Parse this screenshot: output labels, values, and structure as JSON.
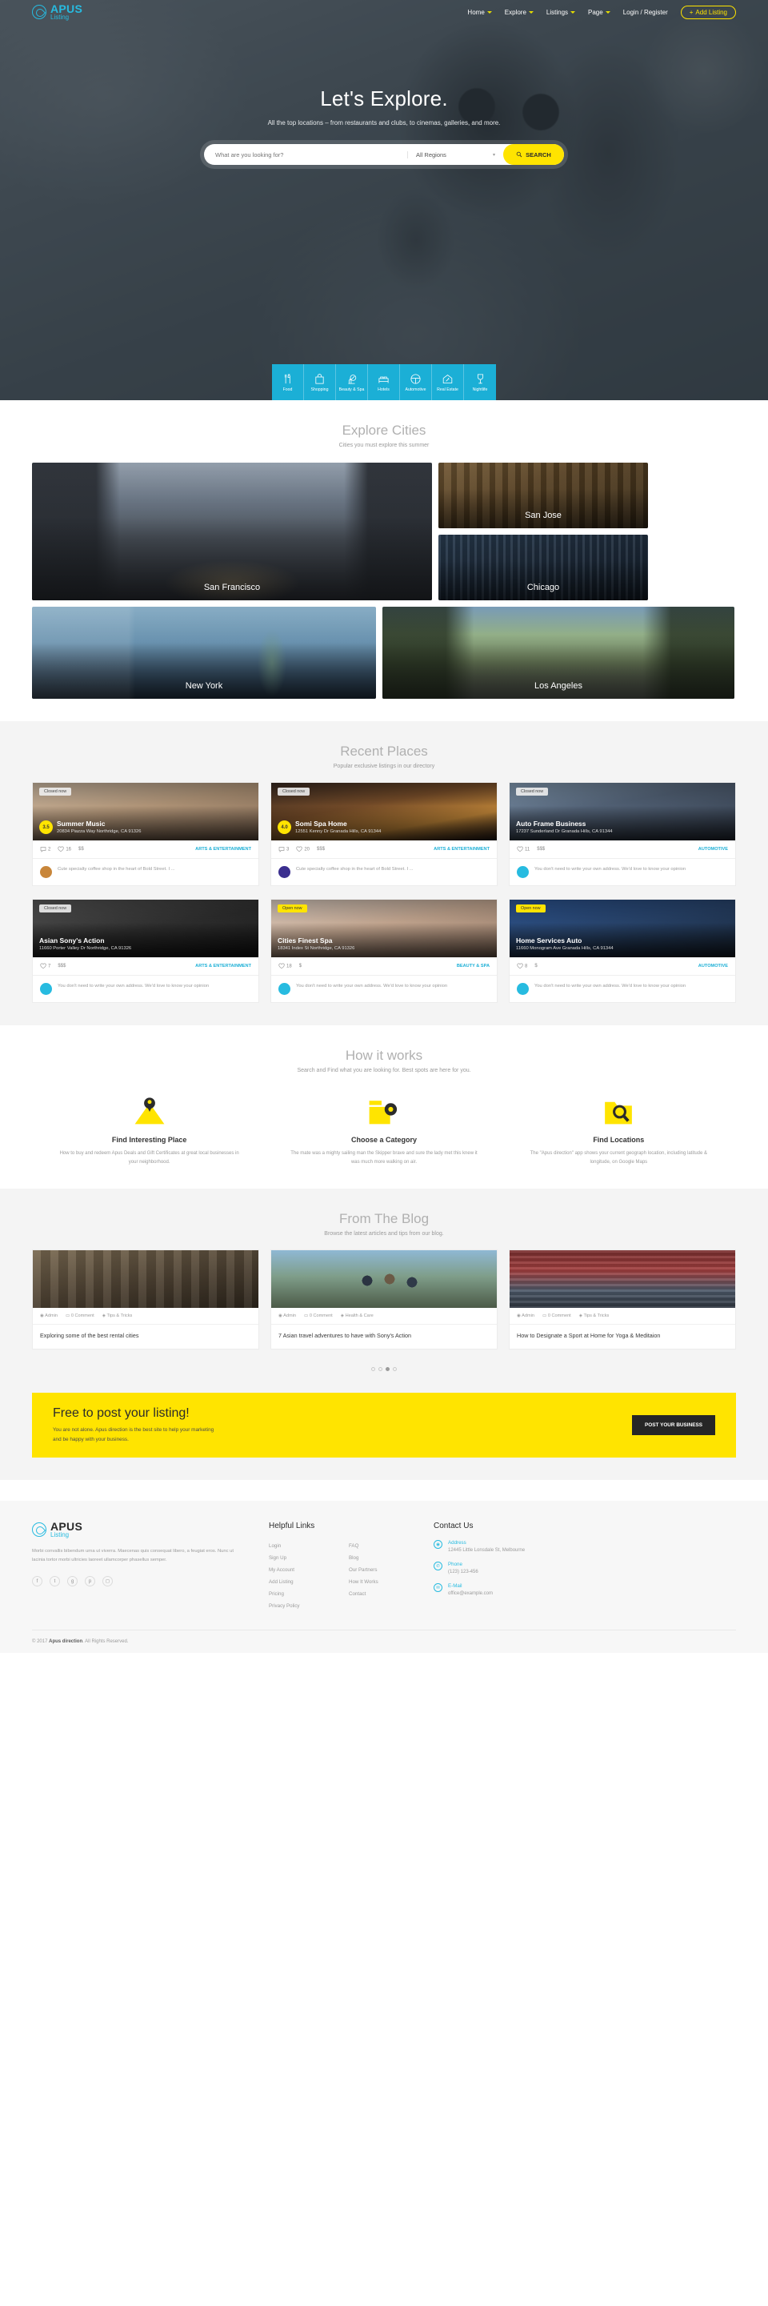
{
  "header": {
    "logo": {
      "line1": "APUS",
      "line2": "Listing",
      "icon": "compass-icon"
    },
    "nav": [
      {
        "label": "Home",
        "caret": true
      },
      {
        "label": "Explore",
        "caret": true
      },
      {
        "label": "Listings",
        "caret": true
      },
      {
        "label": "Page",
        "caret": true
      },
      {
        "label": "Login / Register",
        "caret": false
      }
    ],
    "add_listing": "Add Listing",
    "add_listing_plus": "+"
  },
  "hero": {
    "title": "Let's Explore.",
    "subtitle": "All the top locations – from restaurants and clubs, to cinemas, galleries, and more.",
    "search_placeholder": "What are you looking for?",
    "region_value": "All Regions",
    "search_button": "SEARCH",
    "categories": [
      {
        "label": "Food",
        "icon": "fork-knife-icon"
      },
      {
        "label": "Shopping",
        "icon": "shopping-bag-icon"
      },
      {
        "label": "Beauty & Spa",
        "icon": "lipstick-mirror-icon"
      },
      {
        "label": "Hotels",
        "icon": "bed-icon"
      },
      {
        "label": "Automotive",
        "icon": "steering-wheel-icon"
      },
      {
        "label": "Real Estate",
        "icon": "house-key-icon"
      },
      {
        "label": "Nightlife",
        "icon": "wine-glass-icon"
      }
    ]
  },
  "cities": {
    "title": "Explore Cities",
    "subtitle": "Cities you must explore this summer",
    "items": [
      {
        "name": "San Francisco"
      },
      {
        "name": "San Jose"
      },
      {
        "name": "Chicago"
      },
      {
        "name": "New York"
      },
      {
        "name": "Los Angeles"
      }
    ]
  },
  "recent": {
    "title": "Recent Places",
    "subtitle": "Popular exclusive listings in our directory",
    "comment_text": "Cute specialty coffee shop in the heart of Bold Street. I ...",
    "comment_text_alt": "You don't need to write your own address. We'd love to know your opinion",
    "cards": [
      {
        "status": "Closed now",
        "status_type": "closed",
        "rating": "3.5",
        "title": "Summer Music",
        "address": "20834 Piazza Way Northridge, CA 91326",
        "comments": "2",
        "likes": "16",
        "price": "$$",
        "category": "ARTS & ENTERTAINMENT",
        "avatar": "k",
        "comment": "Cute specialty coffee shop in the heart of Bold Street. I ..."
      },
      {
        "status": "Closed now",
        "status_type": "closed",
        "rating": "4.0",
        "title": "Somi Spa Home",
        "address": "12551 Kenny Dr Granada Hills, CA 91344",
        "comments": "3",
        "likes": "20",
        "price": "$$$",
        "category": "ARTS & ENTERTAINMENT",
        "avatar": "p",
        "comment": "Cute specialty coffee shop in the heart of Bold Street. I ..."
      },
      {
        "status": "Closed now",
        "status_type": "closed",
        "rating": "",
        "title": "Auto Frame Business",
        "address": "17237 Sunderland Dr Granada Hills, CA 91344",
        "comments": "",
        "likes": "11",
        "price": "$$$",
        "category": "AUTOMOTIVE",
        "avatar": "t",
        "comment": "You don't need to write your own address. We'd love to know your opinion"
      },
      {
        "status": "Closed now",
        "status_type": "closed",
        "rating": "",
        "title": "Asian Sony's Action",
        "address": "11660 Porter Valley Dr Northridge, CA 91326",
        "comments": "",
        "likes": "7",
        "price": "$$$",
        "category": "ARTS & ENTERTAINMENT",
        "avatar": "t",
        "comment": "You don't need to write your own address. We'd love to know your opinion"
      },
      {
        "status": "Open now",
        "status_type": "open",
        "rating": "",
        "title": "Cities Finest Spa",
        "address": "18341 Index St Northridge, CA 91326",
        "comments": "",
        "likes": "18",
        "price": "$",
        "category": "BEAUTY & SPA",
        "avatar": "t",
        "comment": "You don't need to write your own address. We'd love to know your opinion"
      },
      {
        "status": "Open now",
        "status_type": "open",
        "rating": "",
        "title": "Home Services Auto",
        "address": "11660 Monogram Ave Granada Hills, CA 91344",
        "comments": "",
        "likes": "8",
        "price": "$",
        "category": "AUTOMOTIVE",
        "avatar": "t",
        "comment": "You don't need to write your own address. We'd love to know your opinion"
      }
    ]
  },
  "how": {
    "title": "How it works",
    "subtitle": "Search and Find what you are looking for. Best spots are here for you.",
    "items": [
      {
        "icon": "map-pin-folder-icon",
        "title": "Find Interesting Place",
        "text": "How to buy and redeem Apus Deals and Gift Certificates at great local businesses in your neighborhood."
      },
      {
        "icon": "category-gear-icon",
        "title": "Choose a Category",
        "text": "The mate was a mighty sailing man the Skipper brave and sure the lady met this knew it was much more walking on air."
      },
      {
        "icon": "search-location-icon",
        "title": "Find Locations",
        "text": "The \"Apus direction\" app shows your current geograph location, including latitude & longitude, on Google Maps"
      }
    ]
  },
  "blog": {
    "title": "From The Blog",
    "subtitle": "Browse the latest articles and tips from our blog.",
    "posts": [
      {
        "author": "Admin",
        "comments": "0 Comment",
        "tag": "Tips & Tricks",
        "title": "Exploring some of the best rental cities"
      },
      {
        "author": "Admin",
        "comments": "0 Comment",
        "tag": "Health & Care",
        "title": "7 Asian travel adventures to have with Sony's Action"
      },
      {
        "author": "Admin",
        "comments": "0 Comment",
        "tag": "Tips & Tricks",
        "title": "How to Designate a Sport at Home for Yoga & Meditaion"
      }
    ],
    "dots": 4,
    "active_dot": 2
  },
  "cta": {
    "title": "Free to post your listing!",
    "line1": "You are not alone. Apus direction is the best site to help your marketing",
    "line2": "and be happy with your business.",
    "button": "POST YOUR BUSINESS",
    "bg": "#ffe400"
  },
  "footer": {
    "logo": {
      "line1": "APUS",
      "line2": "Listing"
    },
    "about": "Morbi convallis bibendum urna ut viverra. Maecenas quis consequat libero, a feugiat eros. Nunc ut lacinia tortor morbi ultricies laoreet ullamcorper phasellus semper.",
    "social": [
      {
        "icon": "facebook-icon",
        "glyph": "f"
      },
      {
        "icon": "twitter-icon",
        "glyph": "t"
      },
      {
        "icon": "google-plus-icon",
        "glyph": "g"
      },
      {
        "icon": "pinterest-icon",
        "glyph": "p"
      },
      {
        "icon": "instagram-icon",
        "glyph": "◻"
      }
    ],
    "helpful": {
      "title": "Helpful Links",
      "col1": [
        "Login",
        "Sign Up",
        "My Account",
        "Add Listing",
        "Pricing",
        "Privacy Policy"
      ],
      "col2": [
        "FAQ",
        "Blog",
        "Our Partners",
        "How It Works",
        "Contact"
      ]
    },
    "contact": {
      "title": "Contact Us",
      "items": [
        {
          "icon": "location-icon",
          "label": "Address",
          "value": "12445 Little Lonsdale St, Melbourne"
        },
        {
          "icon": "phone-icon",
          "label": "Phone",
          "value": "(123) 123-456"
        },
        {
          "icon": "mail-icon",
          "label": "E-Mail",
          "value": "office@example.com"
        }
      ]
    },
    "copyright_pre": "© 2017",
    "copyright_brand": "Apus direction",
    "copyright_post": ". All Rights Reserved."
  }
}
